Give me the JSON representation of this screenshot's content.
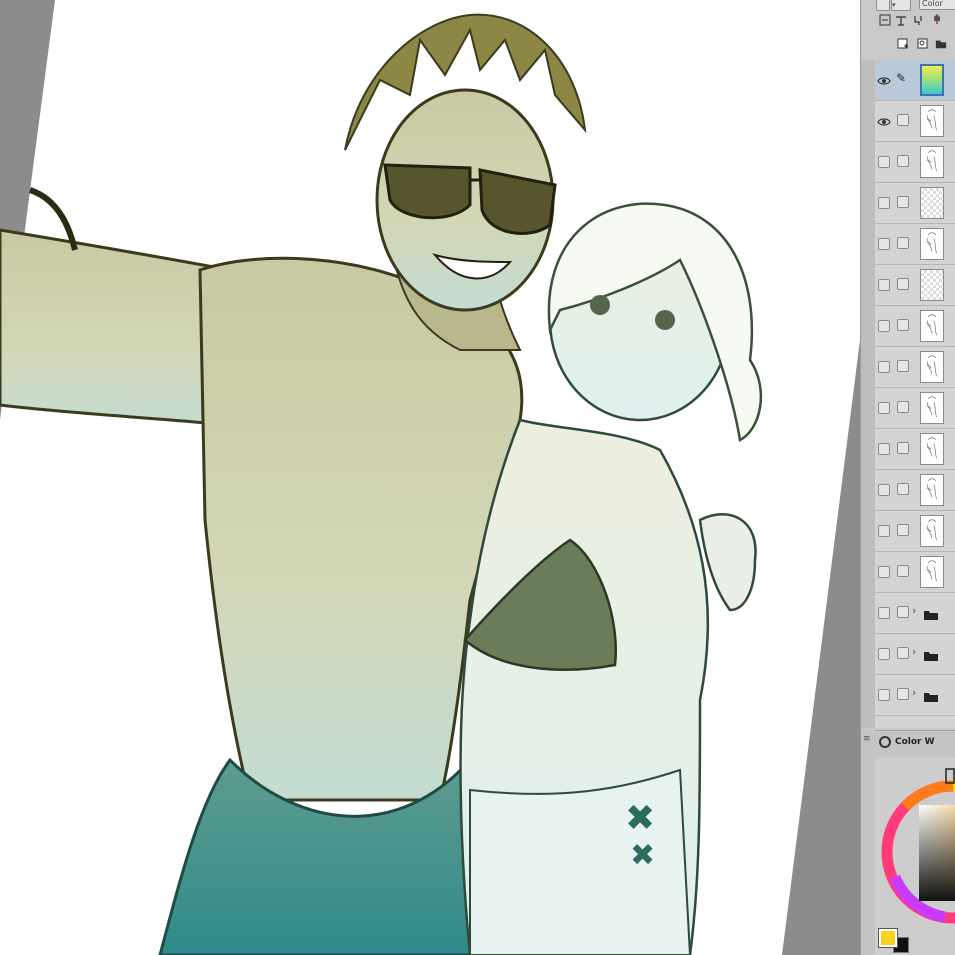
{
  "app": {
    "colors": {
      "panel_bg": "#c9c9c9",
      "canvas_bg": "#8c8c8c",
      "paper": "#ffffff",
      "selected_layer": "#b9c9da"
    }
  },
  "toolbar": {
    "blend_mode_value": "",
    "color_label": "Color",
    "icons": [
      "layer-settings-icon",
      "ruler-icon",
      "mask-icon",
      "reference-icon",
      "new-layer-icon",
      "new-vector-layer-icon",
      "new-folder-icon"
    ]
  },
  "layers": [
    {
      "kind": "gradient",
      "visible": true,
      "selected": true
    },
    {
      "kind": "raster",
      "visible": true
    },
    {
      "kind": "raster",
      "visible": false
    },
    {
      "kind": "empty",
      "visible": false
    },
    {
      "kind": "raster",
      "visible": false
    },
    {
      "kind": "empty",
      "visible": false
    },
    {
      "kind": "raster",
      "visible": false
    },
    {
      "kind": "raster",
      "visible": false
    },
    {
      "kind": "raster",
      "visible": false
    },
    {
      "kind": "raster",
      "visible": false
    },
    {
      "kind": "raster",
      "visible": false
    },
    {
      "kind": "raster",
      "visible": false
    },
    {
      "kind": "raster",
      "visible": false
    },
    {
      "kind": "folder",
      "visible": false
    },
    {
      "kind": "folder",
      "visible": false
    },
    {
      "kind": "folder",
      "visible": false
    },
    {
      "kind": "folder",
      "visible": false
    }
  ],
  "color_panel": {
    "title": "Color W",
    "main_color": "#f6d21a",
    "sub_color": "#111111"
  }
}
